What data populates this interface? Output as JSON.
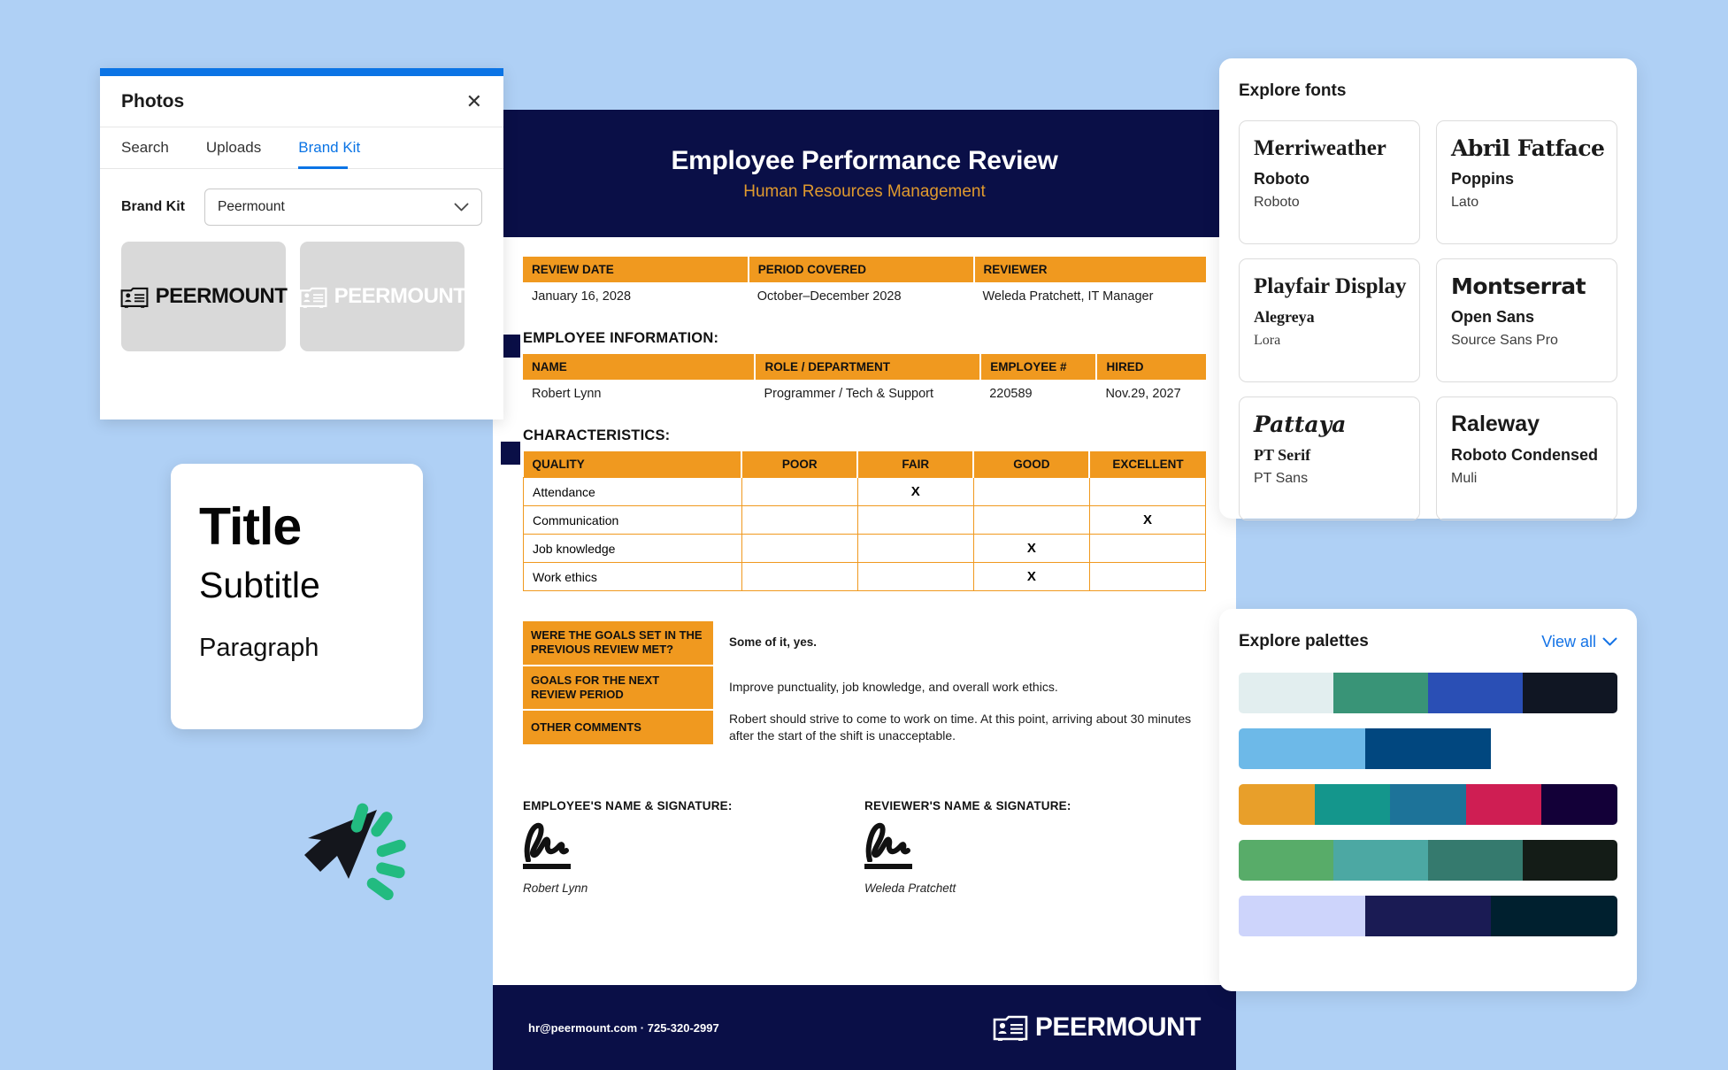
{
  "background_color": "#afd0f5",
  "photos_panel": {
    "accent_color": "#0b74e5",
    "title": "Photos",
    "close_icon": "close-icon",
    "tabs": [
      {
        "label": "Search",
        "active": false
      },
      {
        "label": "Uploads",
        "active": false
      },
      {
        "label": "Brand Kit",
        "active": true
      }
    ],
    "brand_kit_label": "Brand Kit",
    "brand_kit_selected": "Peermount",
    "brand_kit_chevron": "chevron-down-icon",
    "logos": [
      {
        "name": "Peermount dark logo",
        "word": "PEERMOUNT",
        "color": "#111111"
      },
      {
        "name": "Peermount white logo",
        "word": "PEERMOUNT",
        "color": "#ffffff"
      }
    ]
  },
  "title_card": {
    "title": "Title",
    "subtitle": "Subtitle",
    "paragraph": "Paragraph"
  },
  "document": {
    "header": {
      "title": "Employee Performance Review",
      "subtitle": "Human Resources Management",
      "bg_color": "#0a0f47",
      "subtitle_color": "#e09a2e"
    },
    "accent_color": "#f0991f",
    "review_table": {
      "headers": [
        "REVIEW DATE",
        "PERIOD COVERED",
        "REVIEWER"
      ],
      "values": [
        "January 16, 2028",
        "October–December 2028",
        "Weleda Pratchett, IT Manager"
      ]
    },
    "employee_section_title": "EMPLOYEE INFORMATION:",
    "employee_table": {
      "headers": [
        "NAME",
        "ROLE / DEPARTMENT",
        "EMPLOYEE #",
        "HIRED"
      ],
      "values": [
        "Robert Lynn",
        "Programmer / Tech & Support",
        "220589",
        "Nov.29, 2027"
      ]
    },
    "characteristics_section_title": "CHARACTERISTICS:",
    "characteristics_table": {
      "headers": [
        "QUALITY",
        "POOR",
        "FAIR",
        "GOOD",
        "EXCELLENT"
      ],
      "mark": "X",
      "rows": [
        {
          "quality": "Attendance",
          "poor": "",
          "fair": "X",
          "good": "",
          "excellent": ""
        },
        {
          "quality": "Communication",
          "poor": "",
          "fair": "",
          "good": "",
          "excellent": "X"
        },
        {
          "quality": "Job knowledge",
          "poor": "",
          "fair": "",
          "good": "X",
          "excellent": ""
        },
        {
          "quality": "Work ethics",
          "poor": "",
          "fair": "",
          "good": "X",
          "excellent": ""
        }
      ]
    },
    "goals": [
      {
        "label": "WERE THE GOALS SET IN THE PREVIOUS REVIEW MET?",
        "value": "Some of it, yes."
      },
      {
        "label": "GOALS FOR THE NEXT REVIEW PERIOD",
        "value": "Improve punctuality, job knowledge, and overall work ethics."
      },
      {
        "label": "OTHER COMMENTS",
        "value": "Robert should strive to come to work on time. At this point, arriving about 30 minutes after the start of the shift is unacceptable."
      }
    ],
    "signatures": [
      {
        "heading": "EMPLOYEE'S NAME & SIGNATURE:",
        "name": "Robert Lynn"
      },
      {
        "heading": "REVIEWER'S NAME & SIGNATURE:",
        "name": "Weleda Pratchett"
      }
    ],
    "footer": {
      "contact": "hr@peermount.com · 725-320-2997",
      "logo_word": "PEERMOUNT"
    }
  },
  "fonts_panel": {
    "heading": "Explore fonts",
    "cards": [
      {
        "display": "Merriweather",
        "subtitle": "Roboto",
        "paragraph": "Roboto"
      },
      {
        "display": "Abril Fatface",
        "subtitle": "Poppins",
        "paragraph": "Lato"
      },
      {
        "display": "Playfair Display",
        "subtitle": "Alegreya",
        "paragraph": "Lora"
      },
      {
        "display": "Montserrat",
        "subtitle": "Open Sans",
        "paragraph": "Source Sans Pro"
      },
      {
        "display": "Pattaya",
        "subtitle": "PT Serif",
        "paragraph": "PT Sans"
      },
      {
        "display": "Raleway",
        "subtitle": "Roboto Condensed",
        "paragraph": "Muli"
      }
    ]
  },
  "palettes_panel": {
    "heading": "Explore palettes",
    "view_all_label": "View all",
    "view_all_chevron": "chevron-down-icon",
    "palettes": [
      {
        "colors": [
          "#e2eeef",
          "#399477",
          "#2a4fb5",
          "#101623"
        ]
      },
      {
        "colors": [
          "#6db9e8",
          "#01477f",
          "#001córrel"
        ]
      },
      {
        "colors": [
          "#e89f2a",
          "#14968c",
          "#1d7399",
          "#cf1e53",
          "#130038"
        ]
      },
      {
        "colors": [
          "#58ac69",
          "#4ca8a3",
          "#357a6e",
          "#141c17"
        ]
      },
      {
        "colors": [
          "#cdd4fb",
          "#1a1b54",
          "#00202f"
        ]
      }
    ]
  },
  "cursor": {
    "icon": "cursor-arrow-icon",
    "burst_color": "#22bb80"
  }
}
